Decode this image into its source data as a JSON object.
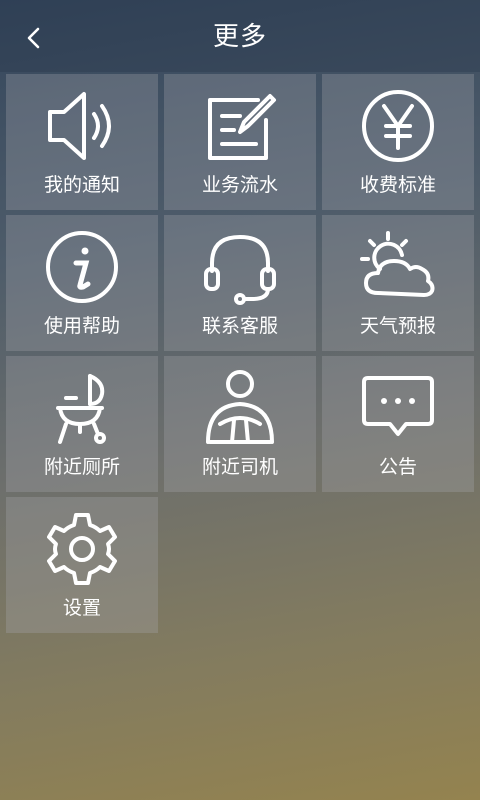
{
  "header": {
    "title": "更多",
    "back_icon": "chevron-left-icon"
  },
  "menu": {
    "items": [
      {
        "label": "我的通知",
        "icon": "speaker-icon"
      },
      {
        "label": "业务流水",
        "icon": "edit-note-icon"
      },
      {
        "label": "收费标准",
        "icon": "yen-icon"
      },
      {
        "label": "使用帮助",
        "icon": "info-icon"
      },
      {
        "label": "联系客服",
        "icon": "headset-icon"
      },
      {
        "label": "天气预报",
        "icon": "weather-icon"
      },
      {
        "label": "附近厕所",
        "icon": "toilet-icon"
      },
      {
        "label": "附近司机",
        "icon": "driver-icon"
      },
      {
        "label": "公告",
        "icon": "chat-bubble-icon"
      },
      {
        "label": "设置",
        "icon": "gear-icon"
      }
    ]
  }
}
